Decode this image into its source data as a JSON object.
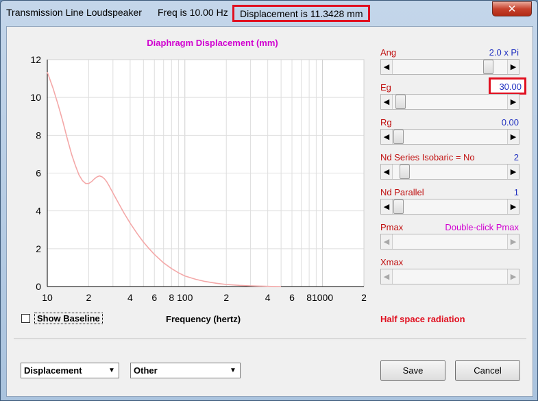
{
  "window": {
    "title": "Transmission Line Loudspeaker",
    "freq": "Freq is 10.00 Hz",
    "displacement": "Displacement is 11.3428 mm",
    "close": "✕"
  },
  "chart_data": {
    "type": "line",
    "title": "Diaphragm Displacement (mm)",
    "xlabel": "Frequency (hertz)",
    "ylabel": "",
    "xscale": "log",
    "xlim": [
      10,
      2000
    ],
    "ylim": [
      0,
      12
    ],
    "yticks": [
      "12",
      "10",
      "8",
      "6",
      "4",
      "2",
      "0"
    ],
    "xticks": [
      "10",
      "2",
      "4",
      "6",
      "8",
      "100",
      "2",
      "4",
      "6",
      "8",
      "1000",
      "2"
    ],
    "grid": true,
    "series": [
      {
        "color": "#f4a8a8",
        "x": [
          10,
          11,
          12,
          13,
          14,
          15,
          16,
          17,
          18,
          19,
          20,
          21,
          22,
          23,
          24,
          25,
          26,
          27,
          28,
          30,
          33,
          36,
          40,
          45,
          50,
          55,
          60,
          70,
          80,
          90,
          100,
          120,
          140,
          170,
          200,
          250,
          300,
          350,
          400,
          450,
          500
        ],
        "y": [
          11.34,
          10.5,
          9.6,
          8.7,
          7.8,
          7.0,
          6.4,
          5.9,
          5.6,
          5.45,
          5.45,
          5.55,
          5.7,
          5.8,
          5.85,
          5.8,
          5.7,
          5.55,
          5.35,
          4.95,
          4.4,
          3.9,
          3.35,
          2.8,
          2.35,
          2.0,
          1.7,
          1.25,
          0.95,
          0.72,
          0.56,
          0.38,
          0.27,
          0.17,
          0.11,
          0.06,
          0.035,
          0.02,
          0.01,
          0.005,
          0.0
        ]
      }
    ]
  },
  "show_baseline": {
    "label": "Show Baseline",
    "checked": false
  },
  "radiation": "Half space radiation",
  "params": [
    {
      "label": "Ang",
      "value": "2.0 x Pi",
      "thumb": 0.87
    },
    {
      "label": "Eg",
      "value": "30.00",
      "thumb": 0.02
    },
    {
      "label": "Rg",
      "value": "0.00",
      "thumb": 0.0
    },
    {
      "label": "Nd Series   Isobaric = No",
      "value": "2",
      "thumb": 0.06
    },
    {
      "label": "Nd  Parallel",
      "value": "1",
      "thumb": 0.0
    },
    {
      "label": "Pmax",
      "value": "Double-click Pmax"
    },
    {
      "label": "Xmax",
      "value": ""
    }
  ],
  "bottom": {
    "combo1": "Displacement",
    "combo2": "Other",
    "save": "Save",
    "cancel": "Cancel"
  },
  "colors": {
    "accent": "#e01020",
    "value": "#2030c0",
    "title": "#d000d0"
  }
}
